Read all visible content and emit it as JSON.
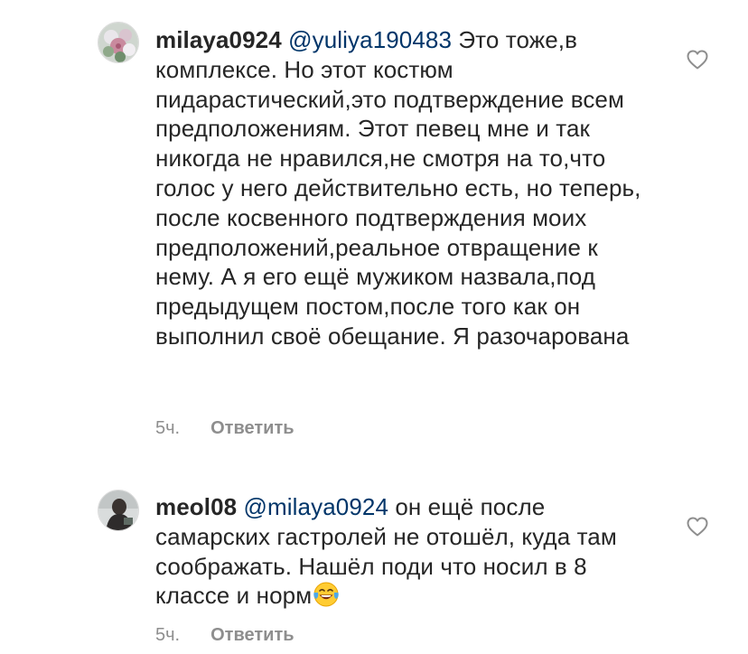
{
  "comments": [
    {
      "username": "milaya0924",
      "mention": "@yuliya190483",
      "text": " Это тоже,в комплексе. Но этот костюм пидарастический,это подтверждение всем предположениям. Этот певец мне и так никогда не нравился,не смотря на то,что голос у него действительно есть, но теперь, после косвенного подтверждения моих предположений,реальное отвращение к нему. А я его ещё мужиком назвала,под предыдущем постом,после того как он выполнил своё обещание. Я разочарована",
      "time": "5ч.",
      "reply_label": "Ответить",
      "avatar_icon": "avatar-flowers",
      "like_icon": "heart-outline-icon"
    },
    {
      "username": "meol08",
      "mention": "@milaya0924",
      "text": " он ещё после самарских гастролей не отошёл, куда там соображать. Нашёл поди что носил в 8 классе и норм",
      "emoji": "face-with-tears-of-joy",
      "time": "5ч.",
      "reply_label": "Ответить",
      "avatar_icon": "avatar-person-dark",
      "like_icon": "heart-outline-icon"
    }
  ],
  "colors": {
    "text": "#262626",
    "mention": "#003569",
    "meta": "#8e8e8e"
  }
}
